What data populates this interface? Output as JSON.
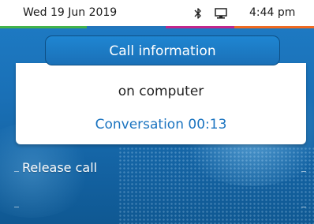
{
  "status_bar": {
    "date": "Wed 19 Jun 2019",
    "time": "4:44 pm",
    "bluetooth_icon": "bluetooth-icon",
    "computer_icon": "computer-icon",
    "strip_colors": [
      "#43b34a",
      "#2475bb",
      "#c2268c",
      "#ef6a22"
    ]
  },
  "dialog": {
    "title": "Call information",
    "line1": "on computer",
    "line2": "Conversation 00:13"
  },
  "softkeys": {
    "release_call": "Release call"
  },
  "colors": {
    "accent_blue": "#1b74c0",
    "background_blue": "#1a70b6"
  }
}
